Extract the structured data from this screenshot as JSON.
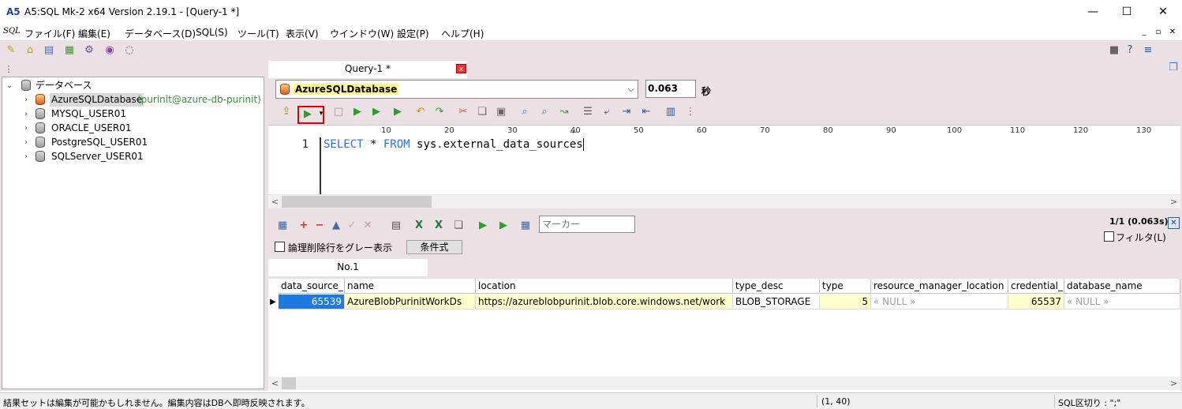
{
  "window": {
    "title": "A5:SQL Mk-2 x64 Version 2.19.1 - [Query-1 *]",
    "icon_text": "A5",
    "minimize": "—",
    "maximize": "☐",
    "close": "✕"
  },
  "menu": {
    "logo": "SQL",
    "items": [
      "ファイル(F)",
      "編集(E)",
      "データベース(D)",
      "SQL(S)",
      "ツール(T)",
      "表示(V)",
      "ウインドウ(W)",
      "設定(P)",
      "ヘルプ(H)"
    ],
    "mdi": [
      "_",
      "▫",
      "✕"
    ]
  },
  "tree": {
    "root_label": "データベース",
    "items": [
      {
        "label": "AzureSQLDatabase",
        "info": "(purinit@azure-db-purinit)"
      },
      {
        "label": "MYSQL_USER01"
      },
      {
        "label": "ORACLE_USER01"
      },
      {
        "label": "PostgreSQL_USER01"
      },
      {
        "label": "SQLServer_USER01"
      }
    ]
  },
  "query_tab": {
    "label": "Query-1 *",
    "close": "x"
  },
  "connection": {
    "selected": "AzureSQLDatabase",
    "arrow": "⌵",
    "elapsed": "0.063",
    "elapsed_unit": "秒"
  },
  "ruler": {
    "marks": [
      "10",
      "20",
      "30",
      "40",
      "50",
      "60",
      "70",
      "80",
      "90",
      "100",
      "110",
      "120",
      "130"
    ]
  },
  "editor": {
    "line_number": "1",
    "code": {
      "kw1": "SELECT",
      "star": " * ",
      "kw2": "FROM",
      "rest": " sys.external_data_sources"
    }
  },
  "scroll": {
    "left": "<",
    "right": ">"
  },
  "results": {
    "marker_placeholder": "マーカー",
    "count": "1/1 (0.063s)",
    "filter_label": "フィルタ(L)",
    "gray_label": "論理削除行をグレー表示",
    "condition_button": "条件式",
    "tab_label": "No.1",
    "columns": [
      "data_source_id",
      "name",
      "location",
      "type_desc",
      "type",
      "resource_manager_location",
      "credential_id",
      "database_name"
    ],
    "row": [
      "65539",
      "AzureBlobPurinitWorkDs",
      "https://azureblobpurinit.blob.core.windows.net/work",
      "BLOB_STORAGE",
      "5",
      "« NULL »",
      "65537",
      "« NULL »"
    ]
  },
  "status": {
    "message": "結果セットは編集が可能かもしれません。編集内容はDBへ即時反映されます。",
    "position": "(1, 40)",
    "delimiter": "SQL区切り : \";\""
  }
}
